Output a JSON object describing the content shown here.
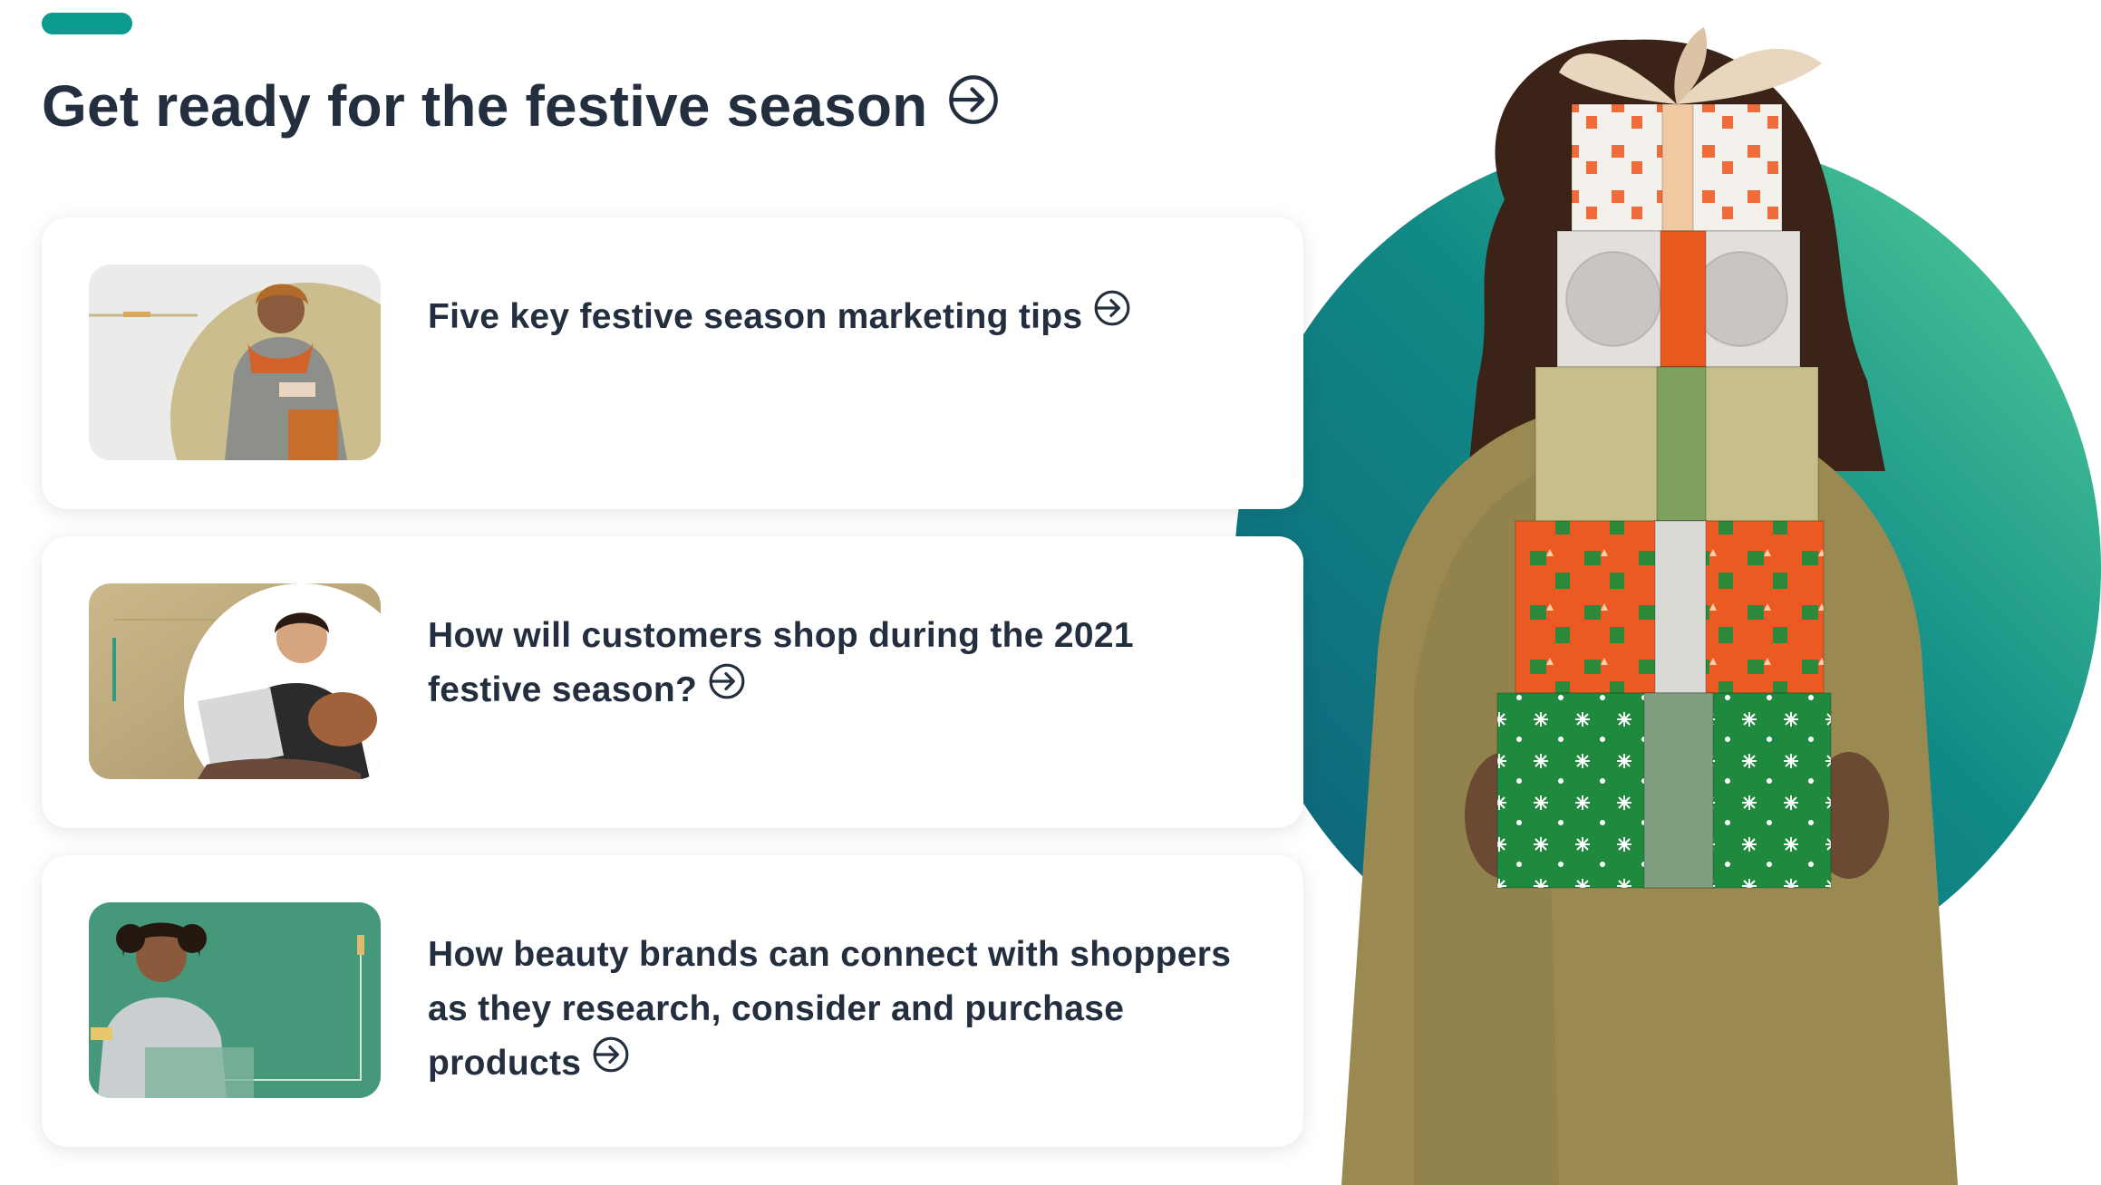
{
  "header": {
    "title": "Get ready for the festive season",
    "accent_color": "#0b9b91",
    "title_icon": "arrow-right-circle-icon"
  },
  "cards": [
    {
      "title": "Five key festive season marketing tips",
      "icon": "arrow-right-circle-icon",
      "thumbnail": "woman-shopping-with-bags"
    },
    {
      "title": "How will customers shop during the 2021 festive season?",
      "icon": "arrow-right-circle-icon",
      "thumbnail": "girl-with-dog-and-laptop"
    },
    {
      "title": "How beauty brands can connect with shoppers as they research, consider and purchase products",
      "icon": "arrow-right-circle-icon",
      "thumbnail": "woman-paying-online"
    }
  ],
  "hero": {
    "image": "woman-holding-stack-of-gift-boxes",
    "circle_gradient": [
      "#0f6e7d",
      "#4fcf9a"
    ]
  }
}
